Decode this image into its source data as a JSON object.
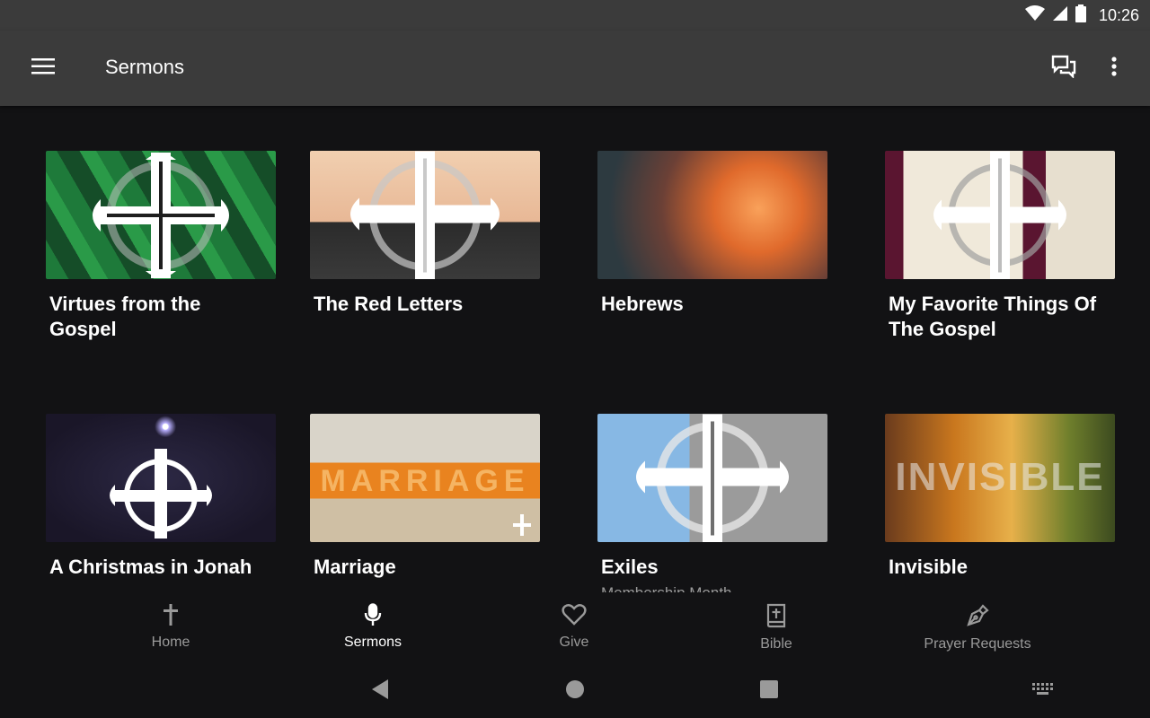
{
  "status_bar": {
    "time": "10:26"
  },
  "app_bar": {
    "title": "Sermons"
  },
  "sermons": [
    {
      "title": "Virtues from the Gospel",
      "subtitle": ""
    },
    {
      "title": "The Red Letters",
      "subtitle": ""
    },
    {
      "title": "Hebrews",
      "subtitle": ""
    },
    {
      "title": "My Favorite Things Of The Gospel",
      "subtitle": ""
    },
    {
      "title": "A Christmas in Jonah",
      "subtitle": ""
    },
    {
      "title": "Marriage",
      "subtitle": ""
    },
    {
      "title": "Exiles",
      "subtitle": "Membership Month"
    },
    {
      "title": "Invisible",
      "subtitle": ""
    }
  ],
  "thumb_text": {
    "marriage": "MARRIAGE",
    "invisible": "INVISIBLE"
  },
  "bottom_nav": {
    "active": "sermons",
    "items": [
      {
        "key": "home",
        "label": "Home",
        "icon": "cross-icon"
      },
      {
        "key": "sermons",
        "label": "Sermons",
        "icon": "microphone-icon"
      },
      {
        "key": "give",
        "label": "Give",
        "icon": "heart-icon"
      },
      {
        "key": "bible",
        "label": "Bible",
        "icon": "bible-icon"
      },
      {
        "key": "prayer",
        "label": "Prayer Requests",
        "icon": "pen-icon"
      }
    ]
  },
  "colors": {
    "app_bar": "#3b3b3b",
    "background": "#121214",
    "inactive": "#9a9a9a",
    "active": "#ffffff"
  }
}
